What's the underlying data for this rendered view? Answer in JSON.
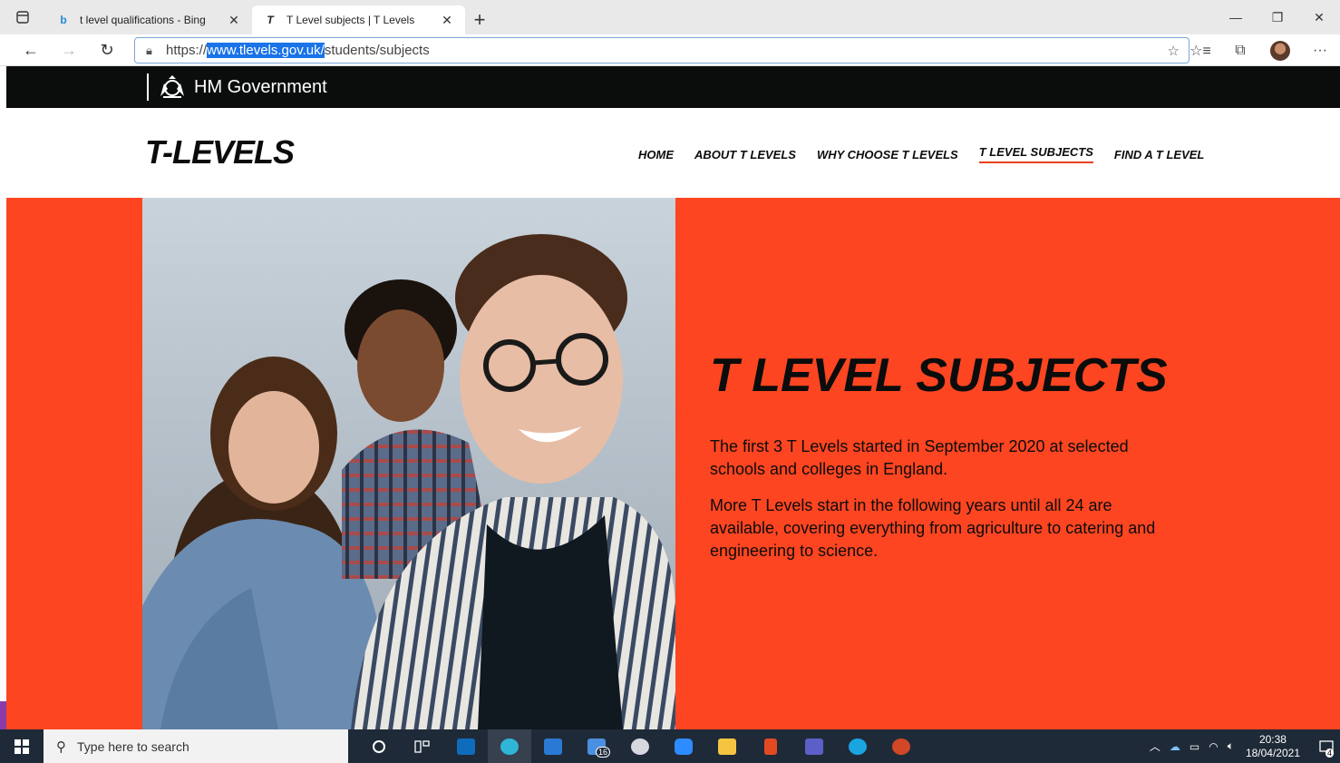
{
  "browser": {
    "tabs": [
      {
        "title": "t level qualifications - Bing",
        "favicon": "bing-icon",
        "active": false
      },
      {
        "title": "T Level subjects | T Levels",
        "favicon": "tlevels-icon",
        "active": true
      }
    ],
    "new_tab_label": "+",
    "url": {
      "prefix": "https://",
      "selected": "www.tlevels.gov.uk/",
      "path": "students/subjects"
    }
  },
  "gov_bar": {
    "brand": "HM Government"
  },
  "site": {
    "logo": "T-LEVELS",
    "nav": [
      {
        "label": "HOME",
        "current": false
      },
      {
        "label": "ABOUT T LEVELS",
        "current": false
      },
      {
        "label": "WHY CHOOSE T LEVELS",
        "current": false
      },
      {
        "label": "T LEVEL SUBJECTS",
        "current": true
      },
      {
        "label": "FIND A T LEVEL",
        "current": false
      }
    ]
  },
  "hero": {
    "title": "T LEVEL SUBJECTS",
    "paragraph1": "The first 3 T Levels started in September 2020 at selected schools and colleges in England.",
    "paragraph2": "More T Levels start in the following years until all 24 are available, covering everything from agriculture to catering and engineering to science.",
    "background_color": "#fd4521"
  },
  "taskbar": {
    "search_placeholder": "Type here to search",
    "mail_badge": "16",
    "time": "20:38",
    "date": "18/04/2021",
    "notification_count": "4"
  }
}
